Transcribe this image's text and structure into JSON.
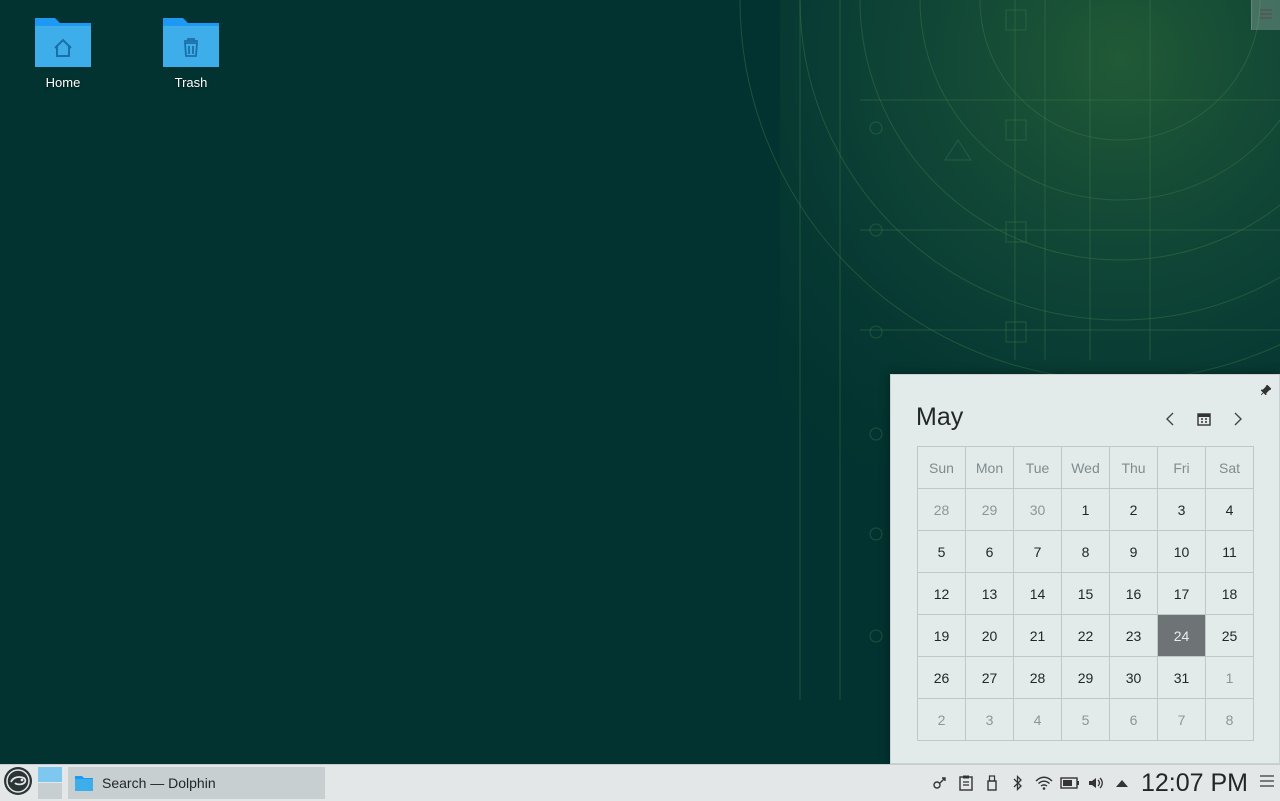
{
  "desktop": {
    "icons": [
      {
        "label": "Home",
        "icon": "home-folder-icon"
      },
      {
        "label": "Trash",
        "icon": "trash-folder-icon"
      }
    ]
  },
  "calendar": {
    "month": "May",
    "weekdays": [
      "Sun",
      "Mon",
      "Tue",
      "Wed",
      "Thu",
      "Fri",
      "Sat"
    ],
    "weeks": [
      [
        "28",
        "29",
        "30",
        "1",
        "2",
        "3",
        "4"
      ],
      [
        "5",
        "6",
        "7",
        "8",
        "9",
        "10",
        "11"
      ],
      [
        "12",
        "13",
        "14",
        "15",
        "16",
        "17",
        "18"
      ],
      [
        "19",
        "20",
        "21",
        "22",
        "23",
        "24",
        "25"
      ],
      [
        "26",
        "27",
        "28",
        "29",
        "30",
        "31",
        "1"
      ],
      [
        "2",
        "3",
        "4",
        "5",
        "6",
        "7",
        "8"
      ]
    ],
    "other_month_cells": [
      [
        0,
        0
      ],
      [
        0,
        1
      ],
      [
        0,
        2
      ],
      [
        4,
        6
      ],
      [
        5,
        0
      ],
      [
        5,
        1
      ],
      [
        5,
        2
      ],
      [
        5,
        3
      ],
      [
        5,
        4
      ],
      [
        5,
        5
      ],
      [
        5,
        6
      ]
    ],
    "today": [
      3,
      5
    ]
  },
  "taskbar": {
    "task_title": "Search — Dolphin",
    "clock": "12:07 PM",
    "tray_icons": [
      "kde-connect-icon",
      "clipboard-icon",
      "usb-device-icon",
      "bluetooth-icon",
      "wifi-icon",
      "battery-icon",
      "volume-icon",
      "expand-tray-icon"
    ]
  },
  "colors": {
    "desktop_bg": "#033330",
    "panel_bg": "#e3e7e8",
    "today_bg": "#6e7475",
    "folder_blue": "#3daee9"
  }
}
